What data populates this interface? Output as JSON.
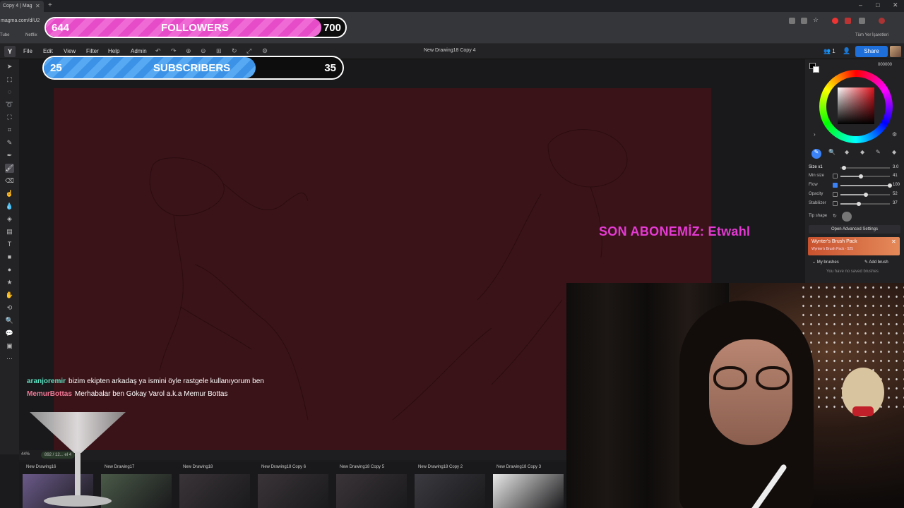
{
  "browser": {
    "tab_title": "Copy 4 | Mag",
    "address": "magma.com/d/U2",
    "bookmarks": [
      "Tube",
      "Netflix"
    ],
    "all_bookmarks_label": "Tüm Yer İşaretleri"
  },
  "app": {
    "logo": "Y",
    "menu": [
      "File",
      "Edit",
      "View",
      "Filter",
      "Help",
      "Admin"
    ],
    "document_title": "New Drawing18 Copy 4",
    "users_count": "1",
    "share_label": "Share"
  },
  "color_panel": {
    "hex": "000000",
    "accent": "#e0101a"
  },
  "brush_settings": {
    "size_label": "Size x1",
    "size_value": "3.0",
    "rows": [
      {
        "label": "Min size",
        "value": "41",
        "fraction": 0.41
      },
      {
        "label": "Flow",
        "value": "100",
        "fraction": 1.0
      },
      {
        "label": "Opacity",
        "value": "52",
        "fraction": 0.52
      },
      {
        "label": "Stabilizer",
        "value": "37",
        "fraction": 0.37
      }
    ],
    "tip_shape_label": "Tip shape",
    "advanced_label": "Open Advanced Settings",
    "pack_title": "Wynter's Brush Pack",
    "pack_sub": "Wynter's Brush Pack · 525",
    "my_brushes_label": "My brushes",
    "add_brush_label": "Add brush",
    "no_brushes_label": "You have no saved brushes"
  },
  "overlay": {
    "followers": {
      "current": "644",
      "label": "FOLLOWERS",
      "goal": "700",
      "progress": 0.92
    },
    "subscribers": {
      "current": "25",
      "label": "SUBSCRIBERS",
      "goal": "35",
      "progress": 0.71
    },
    "last_sub": "SON ABONEMİZ: Etwahl",
    "chat": [
      {
        "user": "aranjoremir",
        "text": "bizim ekipten arkadaş ya ismini öyle rastgele kullanıyorum ben"
      },
      {
        "user": "MemurBottas",
        "text": "Merhabalar ben Gökay Varol a.k.a Memur Bottas"
      }
    ]
  },
  "status": {
    "zoom": "44%",
    "size": "892 / 12... el 4"
  },
  "thumbnails": [
    {
      "label": "New Drawing16",
      "tone": "#6b5a8a"
    },
    {
      "label": "New Drawing17",
      "tone": "#4a5a48"
    },
    {
      "label": "New Drawing18",
      "tone": "#3a3438"
    },
    {
      "label": "New Drawing18 Copy 6",
      "tone": "#3a3438"
    },
    {
      "label": "New Drawing18 Copy 5",
      "tone": "#3a3438"
    },
    {
      "label": "New Drawing18 Copy 2",
      "tone": "#3a3a40"
    },
    {
      "label": "New Drawing18 Copy 3",
      "tone": "#e8e8e8"
    }
  ]
}
